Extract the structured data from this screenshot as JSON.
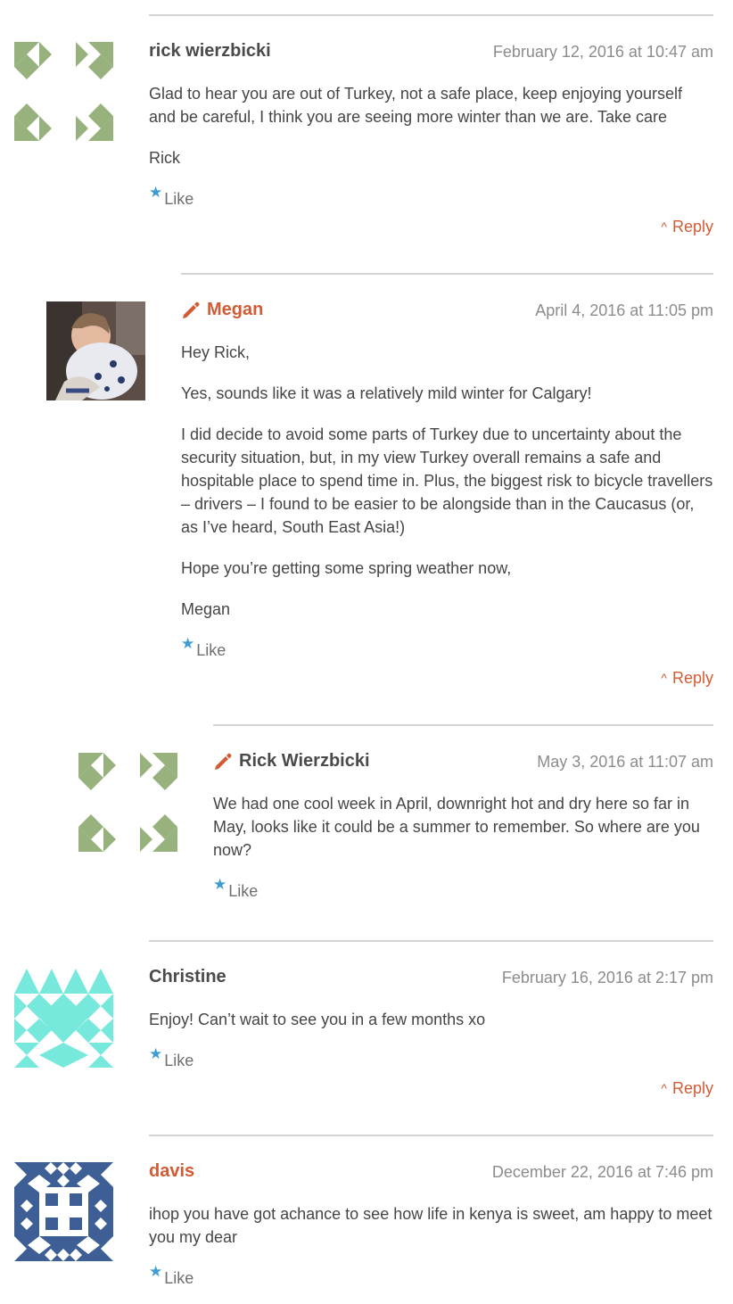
{
  "comments": [
    {
      "author": "rick wierzbicki",
      "date": "February 12, 2016 at 10:47 am",
      "paragraphs": [
        "Glad to hear you are out of Turkey, not a safe place, keep enjoying yourself and be careful, I think you are seeing more winter than we are. Take care",
        "Rick"
      ],
      "like_label": "Like",
      "reply_label": "Reply",
      "avatar_color": "#97b27c"
    },
    {
      "author": "Megan",
      "date": "April 4, 2016 at 11:05 pm",
      "paragraphs": [
        "Hey Rick,",
        "Yes, sounds like it was a relatively mild winter for Calgary!",
        "I did decide to avoid some parts of Turkey due to uncertainty about the security situation, but, in my view Turkey overall remains a safe and hospitable place to spend time in. Plus, the biggest risk to bicycle travellers – drivers – I found to be easier to be alongside than in the Caucasus (or, as I’ve heard, South East Asia!)",
        "Hope you’re getting some spring weather now,",
        "Megan"
      ],
      "like_label": "Like",
      "reply_label": "Reply"
    },
    {
      "author": "Rick Wierzbicki",
      "date": "May 3, 2016 at 11:07 am",
      "paragraphs": [
        "We had one cool week in April, downright hot and dry here so far in May, looks like it could be a summer to remember. So where are you now?"
      ],
      "like_label": "Like",
      "avatar_color": "#97b27c"
    },
    {
      "author": "Christine",
      "date": "February 16, 2016 at 2:17 pm",
      "paragraphs": [
        "Enjoy! Can’t wait to see you in a few months xo"
      ],
      "like_label": "Like",
      "reply_label": "Reply",
      "avatar_color": "#77e8dc"
    },
    {
      "author": "davis",
      "date": "December 22, 2016 at 7:46 pm",
      "paragraphs": [
        "ihop you have got achance to see how life in kenya is sweet, am happy to meet you my dear"
      ],
      "like_label": "Like",
      "avatar_color": "#3d5f95"
    }
  ],
  "colors": {
    "accent": "#d25b35",
    "star": "#3d9dd2",
    "rule": "#d4d4d4",
    "date": "#8c8c8c"
  },
  "icons": {
    "pencil": "pencil-icon",
    "star": "star-icon",
    "reply_caret": "chevron-up-icon"
  }
}
